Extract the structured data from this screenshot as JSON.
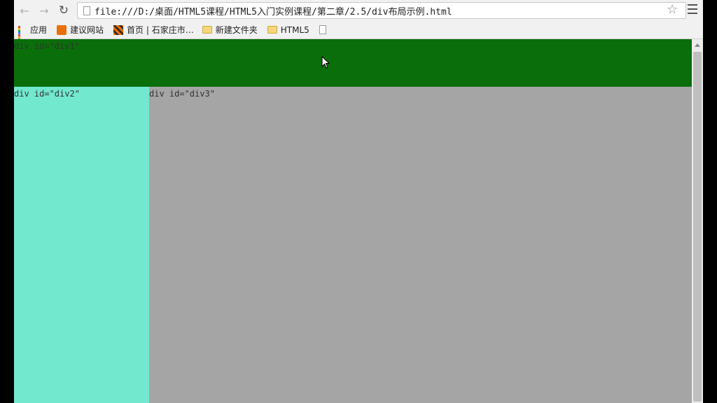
{
  "browser": {
    "url": "file:///D:/桌面/HTML5课程/HTML5入门实例课程/第二章/2.5/div布局示例.html",
    "nav_icons": [
      "back-arrow-icon",
      "forward-arrow-icon",
      "reload-icon"
    ],
    "menu_icon": "hamburger-menu-icon",
    "bookmark_star_icon": "star-icon"
  },
  "bookmarks": [
    {
      "label": "应用",
      "icon": "apps-grid-icon"
    },
    {
      "label": "建议网站",
      "icon": "site-icon"
    },
    {
      "label": "首页 | 石家庄市…",
      "icon": "site-stripe-icon"
    },
    {
      "label": "新建文件夹",
      "icon": "folder-icon"
    },
    {
      "label": "HTML5",
      "icon": "folder-icon"
    },
    {
      "label": "",
      "icon": "page-icon"
    }
  ],
  "page": {
    "div1": {
      "label": "div id=\"div1\"",
      "color": "#0a6e0a"
    },
    "div2": {
      "label": "div id=\"div2\"",
      "color": "#72e8cf"
    },
    "div3": {
      "label": "div id=\"div3\"",
      "color": "#a5a5a5"
    }
  }
}
